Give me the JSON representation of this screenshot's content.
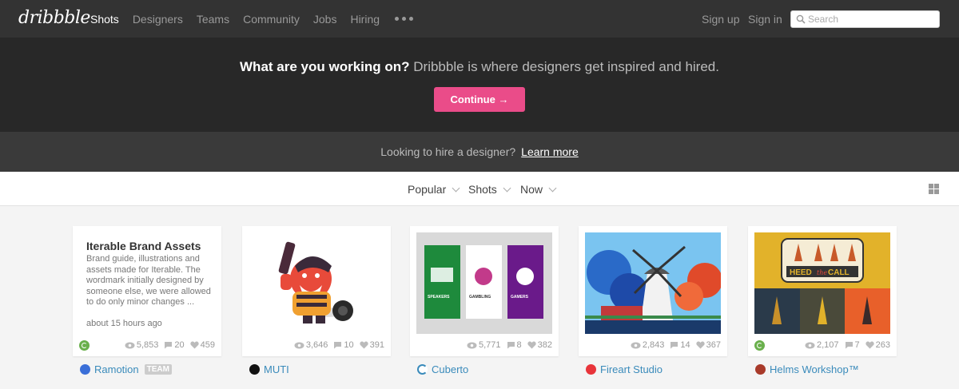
{
  "nav": {
    "logo": "dribbble",
    "links": [
      "Shots",
      "Designers",
      "Teams",
      "Community",
      "Jobs",
      "Hiring"
    ],
    "signup": "Sign up",
    "signin": "Sign in",
    "search_placeholder": "Search"
  },
  "hero": {
    "question": "What are you working on?",
    "tagline": " Dribbble is where designers get inspired and hired.",
    "cta": "Continue →",
    "cta_color": "#ea4c89"
  },
  "hire": {
    "text": "Looking to hire a designer?",
    "link": "Learn more"
  },
  "filters": {
    "sort": "Popular",
    "type": "Shots",
    "time": "Now"
  },
  "shots": [
    {
      "title": "Iterable Brand Assets",
      "description": "Brand guide, illustrations and assets made for Iterable. The wordmark initially designed by someone else, we were allowed to do only minor changes ...",
      "time": "about 15 hours ago",
      "views": "5,853",
      "comments": "20",
      "likes": "459",
      "owner": "Ramotion",
      "badge": "TEAM",
      "rebound": true
    },
    {
      "views": "3,646",
      "comments": "10",
      "likes": "391",
      "owner": "MUTI",
      "rebound": false
    },
    {
      "views": "5,771",
      "comments": "8",
      "likes": "382",
      "owner": "Cuberto",
      "rebound": false,
      "panel_labels": [
        "SPEAKERS",
        "GAMBLING",
        "GAMERS"
      ]
    },
    {
      "views": "2,843",
      "comments": "14",
      "likes": "367",
      "owner": "Fireart Studio",
      "rebound": false
    },
    {
      "views": "2,107",
      "comments": "7",
      "likes": "263",
      "owner": "Helms Workshop™",
      "rebound": true,
      "sign_text_1": "HEED",
      "sign_text_2": "the",
      "sign_text_3": "CALL"
    }
  ]
}
